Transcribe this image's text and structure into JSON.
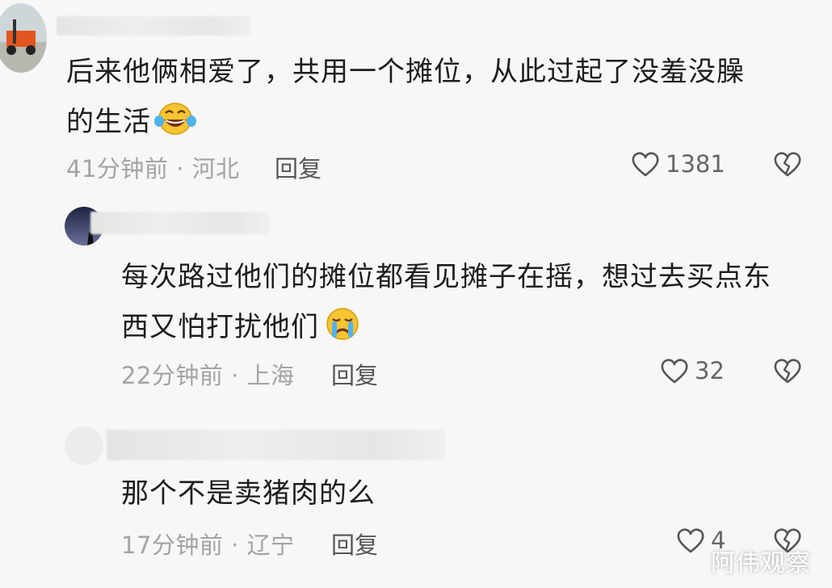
{
  "comments": [
    {
      "text_line1": "后来他俩相爱了，共用一个摊位，从此过起了没羞没臊",
      "text_line2": "的生活",
      "emoji": "laughing-tears-emoji",
      "time": "41分钟前",
      "location": "河北",
      "reply_label": "回复",
      "likes": "1381"
    },
    {
      "text_line1": "每次路过他们的摊位都看见摊子在摇，想过去买点东",
      "text_line2": "西又怕打扰他们",
      "emoji": "crying-emoji",
      "time": "22分钟前",
      "location": "上海",
      "reply_label": "回复",
      "likes": "32"
    },
    {
      "text_line1": "那个不是卖猪肉的么",
      "time": "17分钟前",
      "location": "辽宁",
      "reply_label": "回复",
      "likes": "4"
    }
  ],
  "separator": "·",
  "watermark": "阿伟观察",
  "colors": {
    "background": "#f7f7f7",
    "meta": "#a3a3a3",
    "text": "#1d1d1d"
  }
}
